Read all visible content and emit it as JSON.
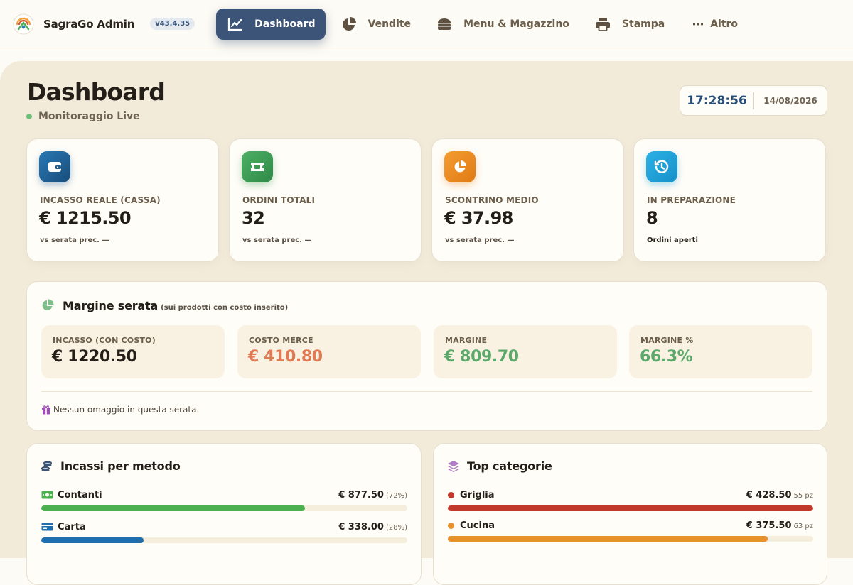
{
  "app": {
    "name": "SagraGo Admin",
    "version": "v43.4.35"
  },
  "nav": {
    "items": [
      {
        "label": "Dashboard",
        "icon": "chart-line-icon"
      },
      {
        "label": "Vendite",
        "icon": "pie-chart-icon"
      },
      {
        "label": "Menu & Magazzino",
        "icon": "burger-icon"
      },
      {
        "label": "Stampa",
        "icon": "printer-icon"
      },
      {
        "label": "Altro",
        "icon": "ellipsis-icon"
      }
    ]
  },
  "header": {
    "title": "Dashboard",
    "status": "Monitoraggio Live"
  },
  "clock": {
    "time": "17:28:56",
    "date": "14/08/2026"
  },
  "kpis": [
    {
      "label": "INCASSO REALE (CASSA)",
      "value": "€ 1215.50",
      "sub": "vs serata prec. —",
      "icon": "wallet-icon",
      "color": "#1f5c8e"
    },
    {
      "label": "ORDINI TOTALI",
      "value": "32",
      "sub": "vs serata prec. —",
      "icon": "ticket-icon",
      "color": "#3d9a55"
    },
    {
      "label": "SCONTRINO MEDIO",
      "value": "€ 37.98",
      "sub": "vs serata prec. —",
      "icon": "pie-chart-icon",
      "color": "#ee8a22"
    },
    {
      "label": "IN PREPARAZIONE",
      "value": "8",
      "sub": "Ordini aperti",
      "icon": "history-icon",
      "color": "#1fa0d8"
    }
  ],
  "margin": {
    "title": "Margine serata",
    "note": "(sui prodotti con costo inserito)",
    "boxes": [
      {
        "label": "INCASSO (CON COSTO)",
        "value": "€ 1220.50",
        "color": "#231e17"
      },
      {
        "label": "COSTO MERCE",
        "value": "€ 410.80",
        "color": "#e07a55"
      },
      {
        "label": "MARGINE",
        "value": "€ 809.70",
        "color": "#5aa86a"
      },
      {
        "label": "MARGINE %",
        "value": "66.3%",
        "color": "#5aa86a"
      }
    ],
    "gift_note": "Nessun omaggio in questa serata."
  },
  "payments": {
    "title": "Incassi per metodo",
    "rows": [
      {
        "name": "Contanti",
        "amount": "€ 877.50",
        "extra": "(72%)",
        "share": 0.72,
        "color": "#4caf50",
        "icon": "cash-icon"
      },
      {
        "name": "Carta",
        "amount": "€ 338.00",
        "extra": "(28%)",
        "share": 0.28,
        "color": "#1f6fb0",
        "icon": "card-icon"
      }
    ]
  },
  "categories": {
    "title": "Top categorie",
    "rows": [
      {
        "name": "Griglia",
        "amount": "€ 428.50",
        "extra": "55 pz",
        "share": 1.0,
        "color": "#c0392b"
      },
      {
        "name": "Cucina",
        "amount": "€ 375.50",
        "extra": "63 pz",
        "share": 0.876,
        "color": "#e8902a"
      }
    ]
  },
  "colors": {
    "accent": "#3c5477",
    "background": "#f3ebda",
    "card": "#fffdf8"
  }
}
